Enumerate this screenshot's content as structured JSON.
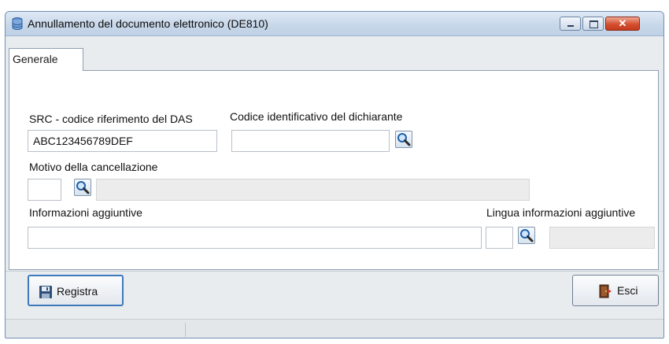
{
  "window": {
    "title": "Annullamento del documento elettronico (DE810)"
  },
  "tabs": [
    {
      "label": "Generale"
    }
  ],
  "form": {
    "src": {
      "label": "SRC - codice riferimento del DAS",
      "value": "ABC123456789DEF"
    },
    "codice_dichiarante": {
      "label": "Codice identificativo del dichiarante",
      "value": ""
    },
    "motivo": {
      "label": "Motivo della cancellazione",
      "code": "",
      "description": ""
    },
    "info_aggiuntive": {
      "label": "Informazioni aggiuntive",
      "value": ""
    },
    "lingua": {
      "label": "Lingua informazioni aggiuntive",
      "code": "",
      "description": ""
    }
  },
  "buttons": {
    "registra": "Registra",
    "esci": "Esci"
  },
  "icons": {
    "app": "database-icon",
    "lookup": "magnifier-icon",
    "save": "floppy-disk-icon",
    "exit": "exit-door-icon"
  },
  "colors": {
    "titlebar": "#c8d8ea",
    "close_button": "#d4502f",
    "default_button_border": "#3f78bd",
    "readonly_field": "#ececec"
  }
}
